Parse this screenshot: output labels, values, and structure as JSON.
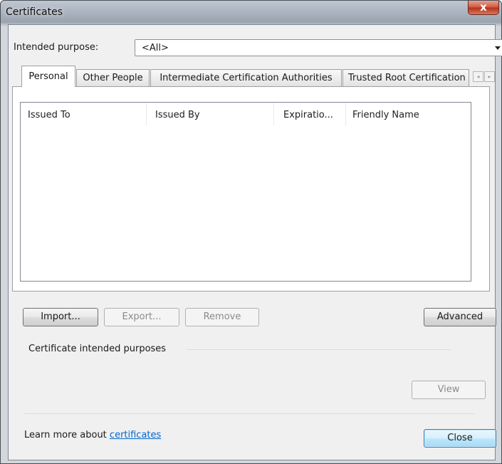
{
  "window": {
    "title": "Certificates",
    "close_glyph": "x"
  },
  "purpose": {
    "label": "Intended purpose:",
    "value": "<All>"
  },
  "tabs": [
    {
      "label": "Personal",
      "active": true
    },
    {
      "label": "Other People",
      "active": false
    },
    {
      "label": "Intermediate Certification Authorities",
      "active": false
    },
    {
      "label": "Trusted Root Certification Authorities",
      "active": false
    }
  ],
  "tab_scroll": {
    "left_glyph": "◂",
    "right_glyph": "▸"
  },
  "list": {
    "columns": [
      "Issued To",
      "Issued By",
      "Expiratio...",
      "Friendly Name"
    ],
    "rows": []
  },
  "buttons": {
    "import": "Import...",
    "export": "Export...",
    "remove": "Remove",
    "advanced": "Advanced",
    "view": "View",
    "close": "Close"
  },
  "purposes_group": {
    "label": "Certificate intended purposes",
    "value": ""
  },
  "footer": {
    "learn_more_prefix": "Learn more about",
    "learn_more_link": "certificates"
  },
  "colors": {
    "link": "#0066cc",
    "close_button": "#c4462b",
    "default_button_border": "#3c7fb1"
  },
  "icons": [
    "close-icon",
    "dropdown-arrow-icon",
    "tab-scroll-left-icon",
    "tab-scroll-right-icon"
  ]
}
